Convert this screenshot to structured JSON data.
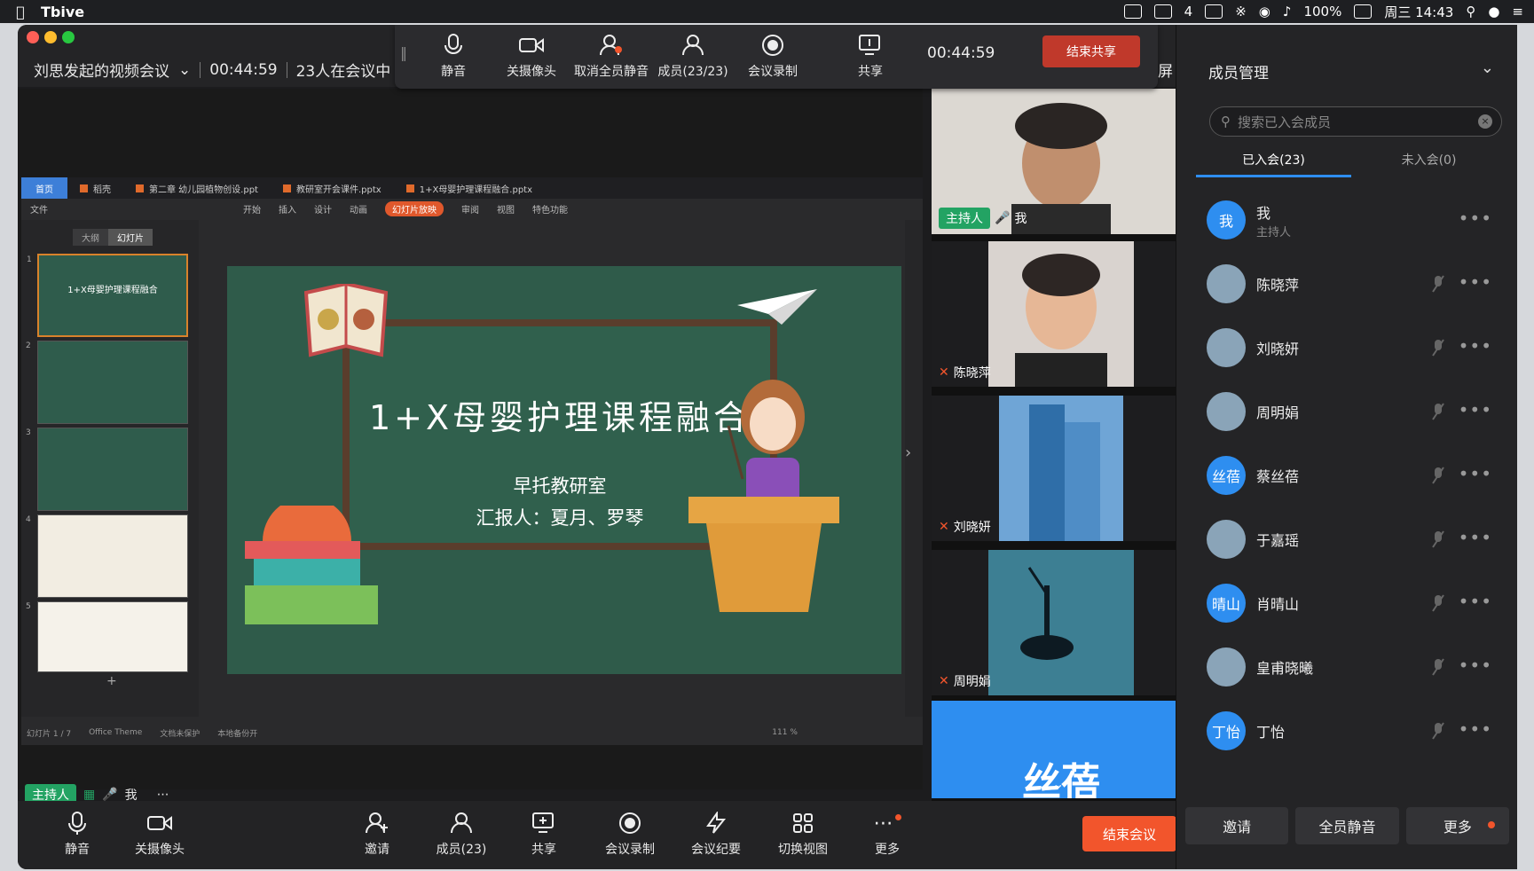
{
  "menubar": {
    "app_name": "Tbive",
    "battery": "100%",
    "clock": "周三 14:43",
    "badge_count": "4"
  },
  "window": {
    "meeting_title": "刘思发起的视频会议",
    "elapsed": "00:44:59",
    "participants_status": "23人在会议中",
    "fullscreen_label": "全屏"
  },
  "float_toolbar": {
    "items": [
      {
        "label": "静音",
        "icon": "microphone-icon"
      },
      {
        "label": "关摄像头",
        "icon": "camera-icon"
      },
      {
        "label": "取消全员静音",
        "icon": "unmute-all-icon"
      },
      {
        "label": "成员(23/23)",
        "icon": "members-icon"
      },
      {
        "label": "会议录制",
        "icon": "record-icon"
      },
      {
        "label": "共享",
        "icon": "share-screen-icon"
      }
    ],
    "timer": "00:44:59",
    "stop_share_label": "结束共享"
  },
  "ppt": {
    "tabs": [
      "首页",
      "稻壳",
      "第二章 幼儿园植物创设.ppt",
      "教研室开会课件.pptx",
      "1+X母婴护理课程融合.pptx"
    ],
    "menu": [
      "文件",
      "开始",
      "插入",
      "设计",
      "动画",
      "幻灯片放映",
      "审阅",
      "视图",
      "特色功能"
    ],
    "active_menu": "幻灯片放映",
    "thumb_tabs": [
      "大纲",
      "幻灯片"
    ],
    "thumbs": [
      {
        "num": "1",
        "title": "1+X母婴护理课程融合"
      },
      {
        "num": "2",
        "title": ""
      },
      {
        "num": "3",
        "title": ""
      },
      {
        "num": "4",
        "title": ""
      },
      {
        "num": "5",
        "title": ""
      }
    ],
    "status_left": "幻灯片 1 / 7",
    "status_theme": "Office Theme",
    "status_protect": "文档未保护",
    "status_backup": "本地备份开",
    "zoom": "111 %"
  },
  "slide": {
    "title": "1+X母婴护理课程融合",
    "subtitle1": "早托教研室",
    "subtitle2": "汇报人：夏月、罗琴"
  },
  "share_host": {
    "host_tag": "主持人",
    "name": "我"
  },
  "bottom_toolbar": {
    "items": [
      {
        "label": "静音",
        "icon": "microphone-icon"
      },
      {
        "label": "关摄像头",
        "icon": "camera-icon"
      },
      {
        "label": "邀请",
        "icon": "invite-icon"
      },
      {
        "label": "成员(23)",
        "icon": "members-icon"
      },
      {
        "label": "共享",
        "icon": "share-screen-icon"
      },
      {
        "label": "会议录制",
        "icon": "record-icon"
      },
      {
        "label": "会议纪要",
        "icon": "minutes-icon"
      },
      {
        "label": "切换视图",
        "icon": "grid-view-icon"
      },
      {
        "label": "更多",
        "icon": "more-icon"
      }
    ],
    "end_meeting_label": "结束会议"
  },
  "videos": [
    {
      "name": "我",
      "host_tag": "主持人"
    },
    {
      "name": "陈晓萍"
    },
    {
      "name": "刘晓妍"
    },
    {
      "name": "周明娟"
    },
    {
      "name": "丝蓓",
      "big_text": "丝蓓"
    }
  ],
  "member_panel": {
    "title": "成员管理",
    "search_placeholder": "搜索已入会成员",
    "tab_joined": "已入会(23)",
    "tab_not_joined": "未入会(0)",
    "members": [
      {
        "name": "我",
        "role": "主持人",
        "avatar_text": "我",
        "photo": false
      },
      {
        "name": "陈晓萍",
        "avatar_text": "",
        "photo": true
      },
      {
        "name": "刘晓妍",
        "avatar_text": "",
        "photo": true
      },
      {
        "name": "周明娟",
        "avatar_text": "",
        "photo": true
      },
      {
        "name": "蔡丝蓓",
        "avatar_text": "丝蓓",
        "photo": false
      },
      {
        "name": "于嘉瑶",
        "avatar_text": "",
        "photo": true
      },
      {
        "name": "肖晴山",
        "avatar_text": "晴山",
        "photo": false
      },
      {
        "name": "皇甫晓曦",
        "avatar_text": "",
        "photo": true
      },
      {
        "name": "丁怡",
        "avatar_text": "丁怡",
        "photo": false
      }
    ],
    "buttons": {
      "invite": "邀请",
      "mute_all": "全员静音",
      "more": "更多"
    }
  },
  "colors": {
    "accent_blue": "#2e8ef0",
    "end_red": "#f2552c",
    "host_green": "#23a363",
    "slide_green": "#2f5b4a"
  }
}
